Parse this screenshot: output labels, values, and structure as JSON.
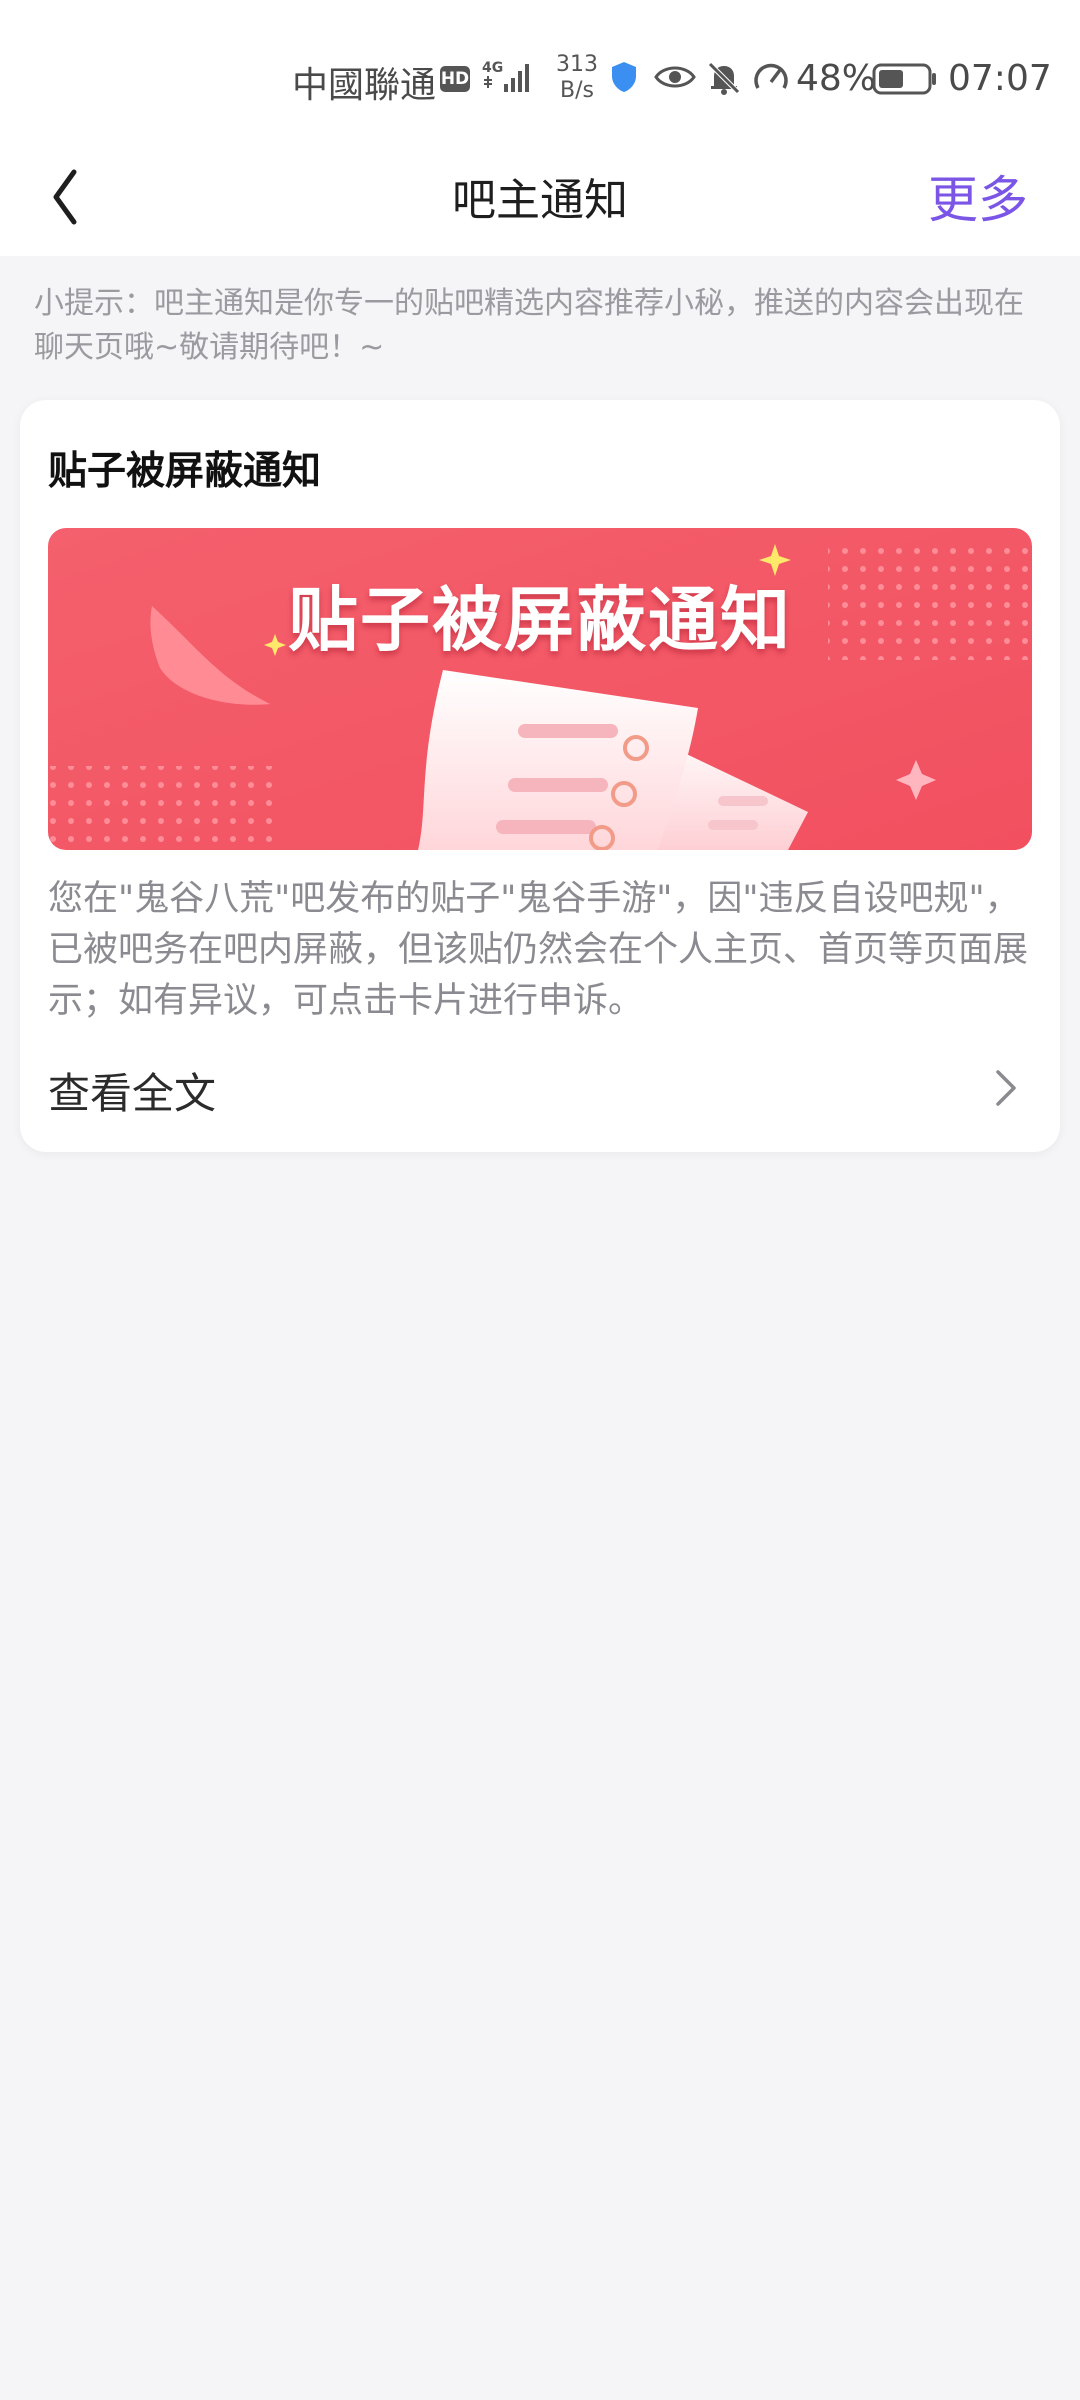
{
  "status_bar": {
    "carrier": "中國聯通",
    "hd_badge": "HD",
    "network": "4G",
    "speed_value": "313",
    "speed_unit": "B/s",
    "battery_percent": "48%",
    "time": "07:07",
    "icons": [
      "shield-icon",
      "eye-icon",
      "bell-off-icon",
      "speedometer-icon",
      "battery-icon"
    ]
  },
  "nav": {
    "title": "吧主通知",
    "more_label": "更多",
    "back_icon": "chevron-left-icon"
  },
  "tip": {
    "text": "小提示：吧主通知是你专一的贴吧精选内容推荐小秘，推送的内容会出现在聊天页哦~敬请期待吧！~"
  },
  "card": {
    "title": "贴子被屏蔽通知",
    "banner_text": "贴子被屏蔽通知",
    "description": "您在\"鬼谷八荒\"吧发布的贴子\"鬼谷手游\"，因\"违反自设吧规\"，已被吧务在吧内屏蔽，但该贴仍然会在个人主页、首页等页面展示；如有异议，可点击卡片进行申诉。",
    "link_label": "查看全文",
    "link_icon": "chevron-right-icon"
  },
  "colors": {
    "accent": "#7a55e6",
    "banner": "#f45a6a",
    "background": "#f5f5f7"
  }
}
